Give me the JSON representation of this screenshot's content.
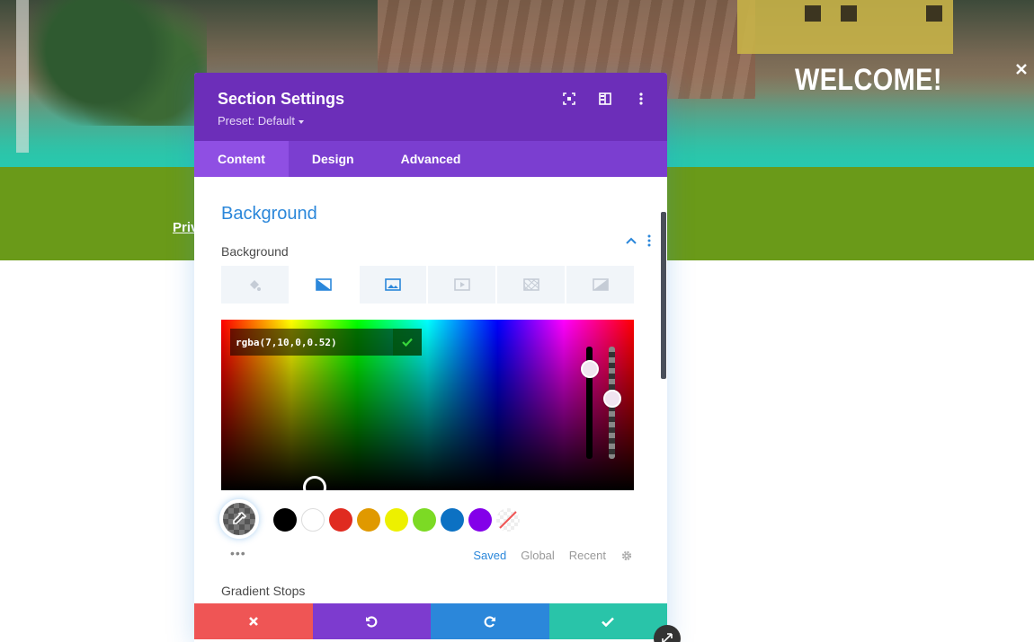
{
  "page": {
    "welcome_text": "WELCOME!",
    "privacy_link": "Priv"
  },
  "modal": {
    "title": "Section Settings",
    "preset": "Preset: Default",
    "header_icons": [
      "focus-icon",
      "split-view-icon",
      "more-vertical-icon"
    ],
    "tabs": [
      {
        "label": "Content",
        "active": true
      },
      {
        "label": "Design",
        "active": false
      },
      {
        "label": "Advanced",
        "active": false
      }
    ]
  },
  "background": {
    "section_title": "Background",
    "field_label": "Background",
    "type_tabs": [
      "color-fill-icon",
      "gradient-icon",
      "image-icon",
      "video-icon",
      "pattern-icon",
      "mask-icon"
    ],
    "active_type": "gradient-icon",
    "color_value": "rgba(7,10,0,0.52)",
    "swatches": [
      "#000000",
      "#ffffff",
      "#e02b20",
      "#e09900",
      "#edf000",
      "#7cda24",
      "#0c71c3",
      "#8300e9"
    ],
    "palette_tabs": [
      {
        "label": "Saved",
        "active": true
      },
      {
        "label": "Global",
        "active": false
      },
      {
        "label": "Recent",
        "active": false
      }
    ],
    "more_label": "•••",
    "gradient_stops_label": "Gradient Stops"
  },
  "footer": {
    "buttons": [
      "cancel-icon",
      "undo-icon",
      "redo-icon",
      "save-check-icon"
    ],
    "colors": [
      "#ef5555",
      "#7d3bcf",
      "#2b87da",
      "#29c4a9"
    ]
  },
  "colors": {
    "header": "#6c2eb9",
    "tabs": "#7b3ed0",
    "accent": "#2b87da",
    "green_band": "#6a9a19"
  }
}
